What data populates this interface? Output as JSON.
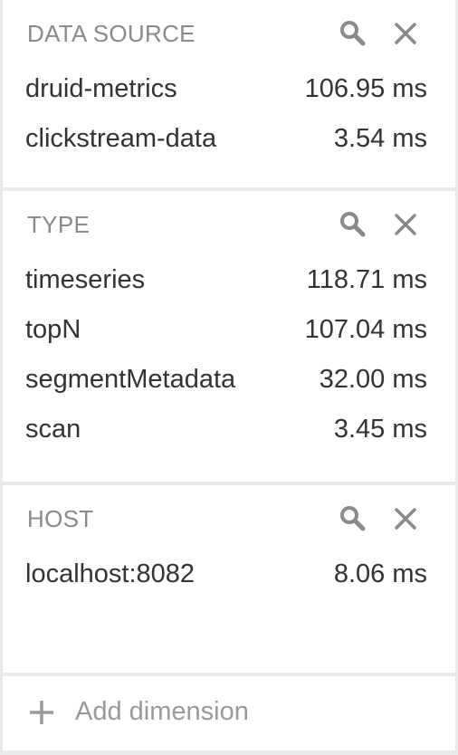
{
  "panels": [
    {
      "title": "DATA SOURCE",
      "rows": [
        {
          "label": "druid-metrics",
          "value": "106.95 ms"
        },
        {
          "label": "clickstream-data",
          "value": "3.54 ms"
        }
      ]
    },
    {
      "title": "TYPE",
      "rows": [
        {
          "label": "timeseries",
          "value": "118.71 ms"
        },
        {
          "label": "topN",
          "value": "107.04 ms"
        },
        {
          "label": "segmentMetadata",
          "value": "32.00 ms"
        },
        {
          "label": "scan",
          "value": "3.45 ms"
        }
      ]
    },
    {
      "title": "HOST",
      "rows": [
        {
          "label": "localhost:8082",
          "value": "8.06 ms"
        }
      ]
    }
  ],
  "add_dimension": {
    "label": "Add dimension"
  },
  "icons": {
    "search": "search-icon",
    "close": "close-icon",
    "add": "plus-icon"
  },
  "colors": {
    "background": "#eaeaea",
    "panel": "#ffffff",
    "text": "#333333",
    "muted": "#8a8a8a"
  }
}
